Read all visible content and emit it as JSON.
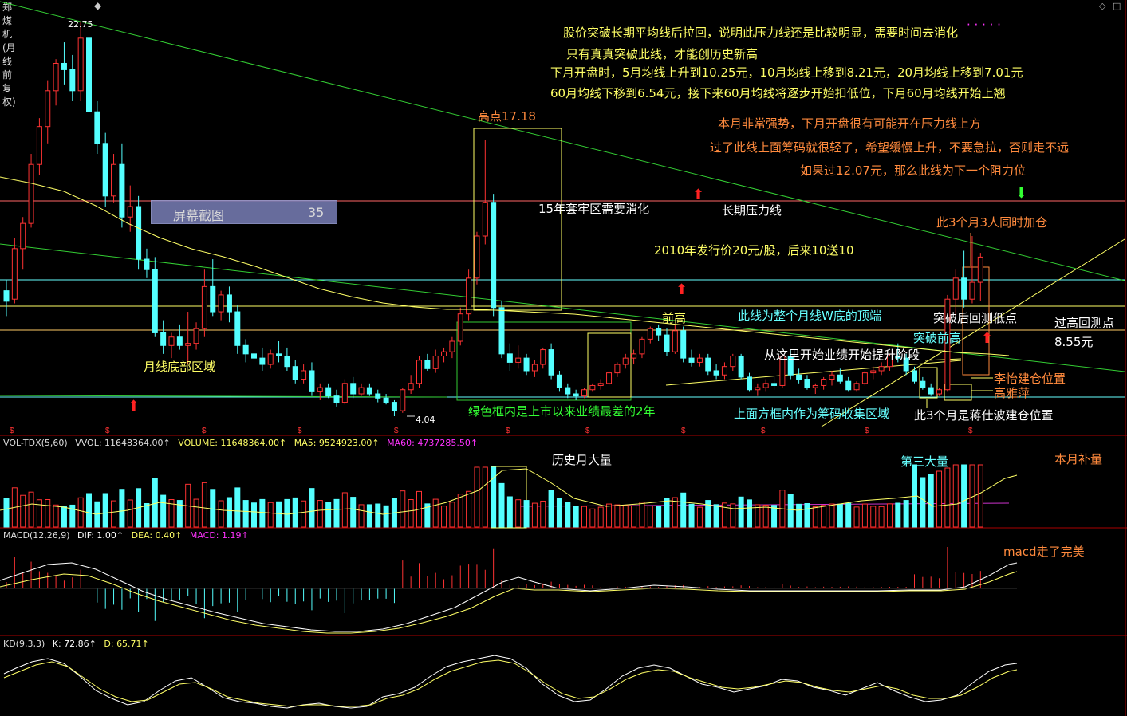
{
  "window": {
    "title": "郑煤机(月线 前复权)",
    "title_marker": "◆",
    "controls": [
      "◇",
      "□"
    ]
  },
  "screenshot_box": {
    "label": "屏幕截图",
    "value": "35"
  },
  "price_labels": {
    "high": "22.75",
    "low": "4.04"
  },
  "annotations": {
    "a1": "股价突破长期平均线后拉回，说明此压力线还是比较明显，需要时间去消化",
    "a1_dots": "· · · · ·",
    "a2": "只有真真突破此线，才能创历史新高",
    "a3": "下月开盘时，5月均线上升到10.25元，10月均线上移到8.21元，20月均线上移到7.01元",
    "a4": "60月均线下移到6.54元，接下来60月均线将逐步开始扣低位，下月60月均线开始上翘",
    "a5": "本月非常强势，下月开盘很有可能开在压力线上方",
    "a6": "过了此线上面筹码就很轻了，希望缓慢上升，不要急拉，否则走不远",
    "a7": "如果过12.07元，那么此线为下一个阻力位",
    "peak": "高点17.18",
    "trap": "15年套牢区需要消化",
    "long_line": "长期压力线",
    "three_add": "此3个月3人同时加仓",
    "issue": "2010年发行价20元/股，后来10送10",
    "prev_high": "前高",
    "w_top": "此线为整个月线W底的顶端",
    "breakback": "突破后回测低点",
    "retest": "过高回测点",
    "retest_price": "8.55元",
    "break_prev": "突破前高",
    "perf": "从这里开始业绩开始提升阶段",
    "bottom_zone": "月线底部区域",
    "li_yi": "李怡建仓位置",
    "gao_yaping": "高雅萍",
    "green_box": "绿色框内是上市以来业绩最差的2年",
    "chip_zone": "上面方框内作为筹码收集区域",
    "jiang": "此3个月是蒋仕波建仓位置",
    "hist_vol": "历史月大量",
    "third_vol": "第三大量",
    "this_vol": "本月补量",
    "macd_note": "macd走了完美"
  },
  "volume_indicator": {
    "name": "VOL-TDX(5,60)",
    "vvol": "VVOL: 11648364.00↑",
    "volume": "VOLUME: 11648364.00↑",
    "ma5": "MA5: 9524923.00↑",
    "ma60": "MA60: 4737285.50↑"
  },
  "macd_indicator": {
    "name": "MACD(12,26,9)",
    "dif": "DIF: 1.00↑",
    "dea": "DEA: 0.40↑",
    "macd": "MACD: 1.19↑"
  },
  "kd_indicator": {
    "name": "KD(9,3,3)",
    "k": "K: 72.86↑",
    "d": "D: 65.71↑"
  },
  "colors": {
    "up": "#ff3333",
    "down": "#54ffff",
    "trend": "#33cc33",
    "ma_yellow": "#ffff66",
    "ma60": "#cc33cc",
    "separator": "#aa0000"
  },
  "chart_data": {
    "type": "candlestick",
    "title": "郑煤机(月线 前复权)",
    "ylim": [
      3,
      24
    ],
    "period": "monthly",
    "candles": [
      [
        10.0,
        10.5,
        8.8,
        9.5
      ],
      [
        9.6,
        12.5,
        9.4,
        12.0
      ],
      [
        12.0,
        13.5,
        11.0,
        13.2
      ],
      [
        13.2,
        16.5,
        13.0,
        16.0
      ],
      [
        16.0,
        18.2,
        15.5,
        17.8
      ],
      [
        17.8,
        20.0,
        17.0,
        19.5
      ],
      [
        19.5,
        21.0,
        18.8,
        20.8
      ],
      [
        20.8,
        21.8,
        19.8,
        20.5
      ],
      [
        20.5,
        21.2,
        19.0,
        19.5
      ],
      [
        19.5,
        22.75,
        19.0,
        22.0
      ],
      [
        22.0,
        22.5,
        18.0,
        18.5
      ],
      [
        18.5,
        19.0,
        16.5,
        17.0
      ],
      [
        17.0,
        17.5,
        14.0,
        14.5
      ],
      [
        14.5,
        16.5,
        14.2,
        16.0
      ],
      [
        16.0,
        17.0,
        13.0,
        13.5
      ],
      [
        13.5,
        15.0,
        12.8,
        14.0
      ],
      [
        14.0,
        14.5,
        11.0,
        11.5
      ],
      [
        11.5,
        12.0,
        10.6,
        11.0
      ],
      [
        11.0,
        11.6,
        7.8,
        8.0
      ],
      [
        8.0,
        8.6,
        7.0,
        7.4
      ],
      [
        7.4,
        8.0,
        6.8,
        7.8
      ],
      [
        7.8,
        8.4,
        7.2,
        7.4
      ],
      [
        7.4,
        9.0,
        6.5,
        7.5
      ],
      [
        7.5,
        8.5,
        7.2,
        8.2
      ],
      [
        8.2,
        11.0,
        7.8,
        10.2
      ],
      [
        10.2,
        11.5,
        8.8,
        9.0
      ],
      [
        9.0,
        10.0,
        8.6,
        9.8
      ],
      [
        9.8,
        10.2,
        8.5,
        9.0
      ],
      [
        9.0,
        9.3,
        7.0,
        7.4
      ],
      [
        7.4,
        7.7,
        6.6,
        7.0
      ],
      [
        7.0,
        7.4,
        6.5,
        6.8
      ],
      [
        6.8,
        7.3,
        6.2,
        6.5
      ],
      [
        6.5,
        7.2,
        6.3,
        7.0
      ],
      [
        7.0,
        7.6,
        6.6,
        6.9
      ],
      [
        6.9,
        7.3,
        6.2,
        6.4
      ],
      [
        6.4,
        6.7,
        5.6,
        5.8
      ],
      [
        5.8,
        6.5,
        5.6,
        6.2
      ],
      [
        6.2,
        6.6,
        5.0,
        5.2
      ],
      [
        5.2,
        5.6,
        4.8,
        5.4
      ],
      [
        5.4,
        5.6,
        4.9,
        5.0
      ],
      [
        5.0,
        5.3,
        4.5,
        4.7
      ],
      [
        4.7,
        5.8,
        4.6,
        5.6
      ],
      [
        5.6,
        5.9,
        4.9,
        5.1
      ],
      [
        5.1,
        5.6,
        5.0,
        5.4
      ],
      [
        5.4,
        5.6,
        5.0,
        5.1
      ],
      [
        5.1,
        5.3,
        4.7,
        4.9
      ],
      [
        4.9,
        5.1,
        4.6,
        4.7
      ],
      [
        4.7,
        4.8,
        4.04,
        4.3
      ],
      [
        4.3,
        5.4,
        4.2,
        5.3
      ],
      [
        5.3,
        6.0,
        5.1,
        5.6
      ],
      [
        5.6,
        6.9,
        5.4,
        6.7
      ],
      [
        6.7,
        7.0,
        6.2,
        6.3
      ],
      [
        6.3,
        7.2,
        6.1,
        6.9
      ],
      [
        6.9,
        7.3,
        6.6,
        7.1
      ],
      [
        7.1,
        7.8,
        6.8,
        7.6
      ],
      [
        7.6,
        9.2,
        7.4,
        8.9
      ],
      [
        8.9,
        11.0,
        8.6,
        10.6
      ],
      [
        10.6,
        12.8,
        10.3,
        12.6
      ],
      [
        12.6,
        17.18,
        12.2,
        14.2
      ],
      [
        14.2,
        14.6,
        8.8,
        9.2
      ],
      [
        9.2,
        9.5,
        6.8,
        7.0
      ],
      [
        7.0,
        7.5,
        6.2,
        6.6
      ],
      [
        6.6,
        7.4,
        6.3,
        6.8
      ],
      [
        6.8,
        7.0,
        6.0,
        6.2
      ],
      [
        6.2,
        6.7,
        5.9,
        6.5
      ],
      [
        6.5,
        7.3,
        6.3,
        7.2
      ],
      [
        7.2,
        7.5,
        5.8,
        6.0
      ],
      [
        6.0,
        6.2,
        5.2,
        5.4
      ],
      [
        5.4,
        5.6,
        4.9,
        5.1
      ],
      [
        5.1,
        5.3,
        4.8,
        5.0
      ],
      [
        5.0,
        5.4,
        4.9,
        5.3
      ],
      [
        5.3,
        5.6,
        5.2,
        5.5
      ],
      [
        5.5,
        5.8,
        5.3,
        5.6
      ],
      [
        5.6,
        6.2,
        5.5,
        6.1
      ],
      [
        6.1,
        6.6,
        5.9,
        6.5
      ],
      [
        6.5,
        7.0,
        6.3,
        6.8
      ],
      [
        6.8,
        7.2,
        6.5,
        7.0
      ],
      [
        7.0,
        7.8,
        6.8,
        7.7
      ],
      [
        7.7,
        8.3,
        7.5,
        8.2
      ],
      [
        8.2,
        8.4,
        7.6,
        7.9
      ],
      [
        7.9,
        8.2,
        6.9,
        7.1
      ],
      [
        7.1,
        8.4,
        7.0,
        8.1
      ],
      [
        8.1,
        8.3,
        6.6,
        6.8
      ],
      [
        6.8,
        7.2,
        6.4,
        6.6
      ],
      [
        6.6,
        7.0,
        6.4,
        6.8
      ],
      [
        6.8,
        7.0,
        6.0,
        6.2
      ],
      [
        6.2,
        6.5,
        5.8,
        6.0
      ],
      [
        6.0,
        6.6,
        5.8,
        6.4
      ],
      [
        6.4,
        7.0,
        6.2,
        6.9
      ],
      [
        6.9,
        7.0,
        5.8,
        5.9
      ],
      [
        5.9,
        6.1,
        5.2,
        5.3
      ],
      [
        5.3,
        5.6,
        5.0,
        5.4
      ],
      [
        5.4,
        5.8,
        5.2,
        5.6
      ],
      [
        5.6,
        5.9,
        5.3,
        5.5
      ],
      [
        5.5,
        7.0,
        5.4,
        6.9
      ],
      [
        6.9,
        7.2,
        5.8,
        6.0
      ],
      [
        6.0,
        6.3,
        5.6,
        5.8
      ],
      [
        5.8,
        6.0,
        5.3,
        5.4
      ],
      [
        5.4,
        5.6,
        5.1,
        5.5
      ],
      [
        5.5,
        5.9,
        5.3,
        5.8
      ],
      [
        5.8,
        6.2,
        5.5,
        6.0
      ],
      [
        6.0,
        6.3,
        5.6,
        5.7
      ],
      [
        5.7,
        5.9,
        5.2,
        5.3
      ],
      [
        5.3,
        5.7,
        5.2,
        5.6
      ],
      [
        5.6,
        6.2,
        5.5,
        6.1
      ],
      [
        6.1,
        6.4,
        5.8,
        6.2
      ],
      [
        6.2,
        6.6,
        6.0,
        6.4
      ],
      [
        6.4,
        7.0,
        6.2,
        6.9
      ],
      [
        6.9,
        7.5,
        6.6,
        6.8
      ],
      [
        6.8,
        7.0,
        6.0,
        6.2
      ],
      [
        6.2,
        6.4,
        5.6,
        5.7
      ],
      [
        5.7,
        5.9,
        5.3,
        5.4
      ],
      [
        5.4,
        5.6,
        5.0,
        5.1
      ],
      [
        5.1,
        5.4,
        5.0,
        5.3
      ],
      [
        5.3,
        9.8,
        5.2,
        9.6
      ],
      [
        9.6,
        11.0,
        8.8,
        10.6
      ],
      [
        10.6,
        11.9,
        9.2,
        9.6
      ],
      [
        9.6,
        12.6,
        9.4,
        10.4
      ],
      [
        10.4,
        11.8,
        9.5,
        11.6
      ]
    ]
  }
}
